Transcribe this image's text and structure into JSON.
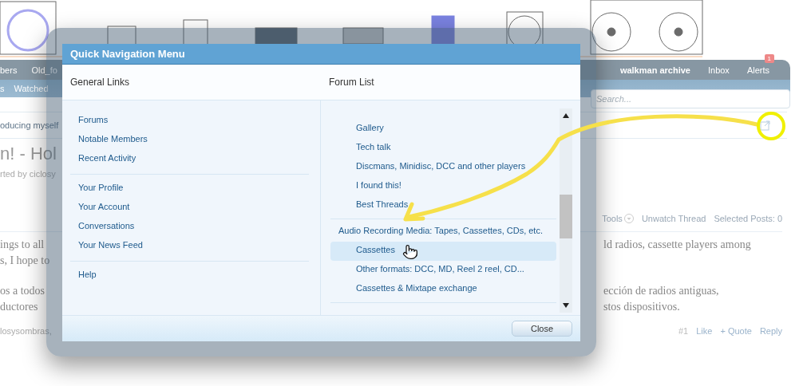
{
  "nav": {
    "left": [
      "bers",
      "Old_fo"
    ],
    "right": [
      {
        "label": "walkman archive"
      },
      {
        "label": "Inbox"
      },
      {
        "label": "Alerts",
        "badge": "1"
      }
    ]
  },
  "subnav": {
    "items": [
      "s",
      "Watched"
    ],
    "search": {
      "placeholder": "Search..."
    }
  },
  "thread": {
    "breadcrumb": "oducing myself",
    "title": "n! - Hol",
    "byline": "rted by ciclosy",
    "tools": [
      {
        "label": "Tools",
        "kind": "menu"
      },
      {
        "label": "Unwatch Thread",
        "kind": "link"
      },
      {
        "label": "Selected Posts: 0",
        "kind": "link"
      }
    ],
    "post": {
      "paragraphs": [
        [
          {
            "left": "ings to all",
            "right": "ld radios, cassette players among"
          },
          {
            "left": "s, I hope to"
          }
        ],
        [
          {
            "left": "os a todos",
            "right": "ección de radios antiguas,"
          },
          {
            "left": "ductores",
            "right": "stos dispositivos."
          }
        ]
      ],
      "author": "losysombras,",
      "actions": [
        "#1",
        "Like",
        "+ Quote",
        "Reply"
      ]
    }
  },
  "modal": {
    "title": "Quick Navigation Menu",
    "general_links": {
      "heading": "General Links",
      "groups": [
        [
          "Forums",
          "Notable Members",
          "Recent Activity"
        ],
        [
          "Your Profile",
          "Your Account",
          "Conversations",
          "Your News Feed"
        ],
        [
          "Help"
        ]
      ]
    },
    "forum_list": {
      "heading": "Forum List",
      "groups": [
        {
          "items": [
            {
              "label": "Gallery",
              "selected": false
            },
            {
              "label": "Tech talk",
              "selected": false
            },
            {
              "label": "Discmans, Minidisc, DCC and other players",
              "selected": false
            },
            {
              "label": "I found this!",
              "selected": false
            },
            {
              "label": "Best Threads",
              "selected": false
            }
          ]
        },
        {
          "category": "Audio Recording Media: Tapes, Cassettes, CDs, etc.",
          "items": [
            {
              "label": "Cassettes",
              "selected": true
            },
            {
              "label": "Other formats: DCC, MD, Reel 2 reel, CD...",
              "selected": false
            },
            {
              "label": "Cassettes & Mixtape exchange",
              "selected": false
            }
          ]
        }
      ]
    },
    "close": "Close"
  }
}
